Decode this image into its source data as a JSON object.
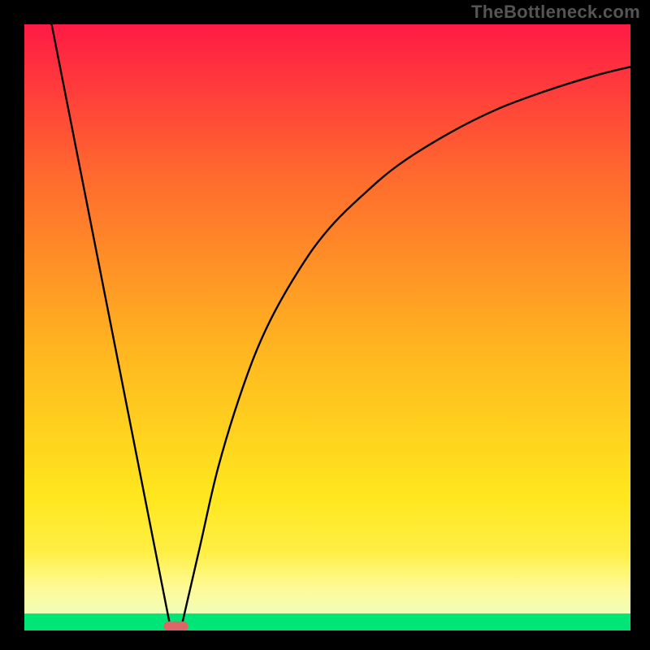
{
  "watermark": "TheBottleneck.com",
  "chart_data": {
    "type": "line",
    "title": "",
    "xlabel": "",
    "ylabel": "",
    "xlim": [
      0,
      100
    ],
    "ylim": [
      0,
      100
    ],
    "grid": false,
    "background_gradient": [
      "#ff1a45",
      "#ff6a2e",
      "#ffb91f",
      "#ffe71e",
      "#fff35a",
      "#00e676"
    ],
    "series": [
      {
        "name": "left-segment",
        "x": [
          4.5,
          24.0
        ],
        "y": [
          100,
          1.0
        ]
      },
      {
        "name": "right-curve",
        "x": [
          26.0,
          29,
          32,
          36,
          40,
          45,
          50,
          56,
          62,
          70,
          78,
          86,
          94,
          100
        ],
        "y": [
          1.0,
          14,
          27,
          40,
          50,
          59,
          66,
          72,
          77,
          82,
          86,
          89,
          91.5,
          93
        ]
      }
    ],
    "marker": {
      "x0": 23.0,
      "x1": 27.0,
      "y": 0.7,
      "rx": 1.6
    },
    "green_band": {
      "y0": 0,
      "y1": 2.8
    },
    "pale_band": {
      "y0": 2.8,
      "y1": 13
    }
  }
}
